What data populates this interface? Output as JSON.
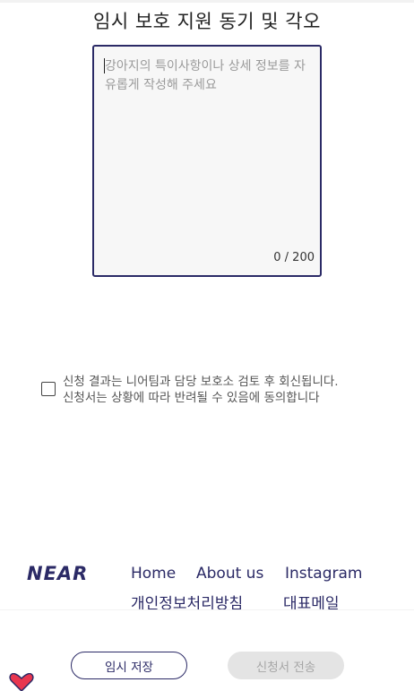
{
  "page": {
    "title": "임시 보호 지원 동기 및 각오"
  },
  "motivation": {
    "placeholder": "강아지의 특이사항이나 상세 정보를 자유롭게 작성해 주세요",
    "value": "",
    "counter": "0 / 200"
  },
  "consent": {
    "checked": false,
    "line1": "신청 결과는 니어팀과 담당 보호소 검토 후 회신됩니다.",
    "line2": "신청서는 상황에 따라 반려될 수 있음에 동의합니다"
  },
  "footer": {
    "logo": "NEAR",
    "links": {
      "home": "Home",
      "about": "About us",
      "instagram": "Instagram",
      "privacy": "개인정보처리방침",
      "mail": "대표메일"
    }
  },
  "actions": {
    "save_label": "임시 저장",
    "submit_label": "신청서 전송"
  },
  "colors": {
    "brand": "#2b2a66",
    "disabled_bg": "#e4e4e4",
    "heart": "#e8364f"
  },
  "icons": {
    "floating": "heart-icon"
  }
}
